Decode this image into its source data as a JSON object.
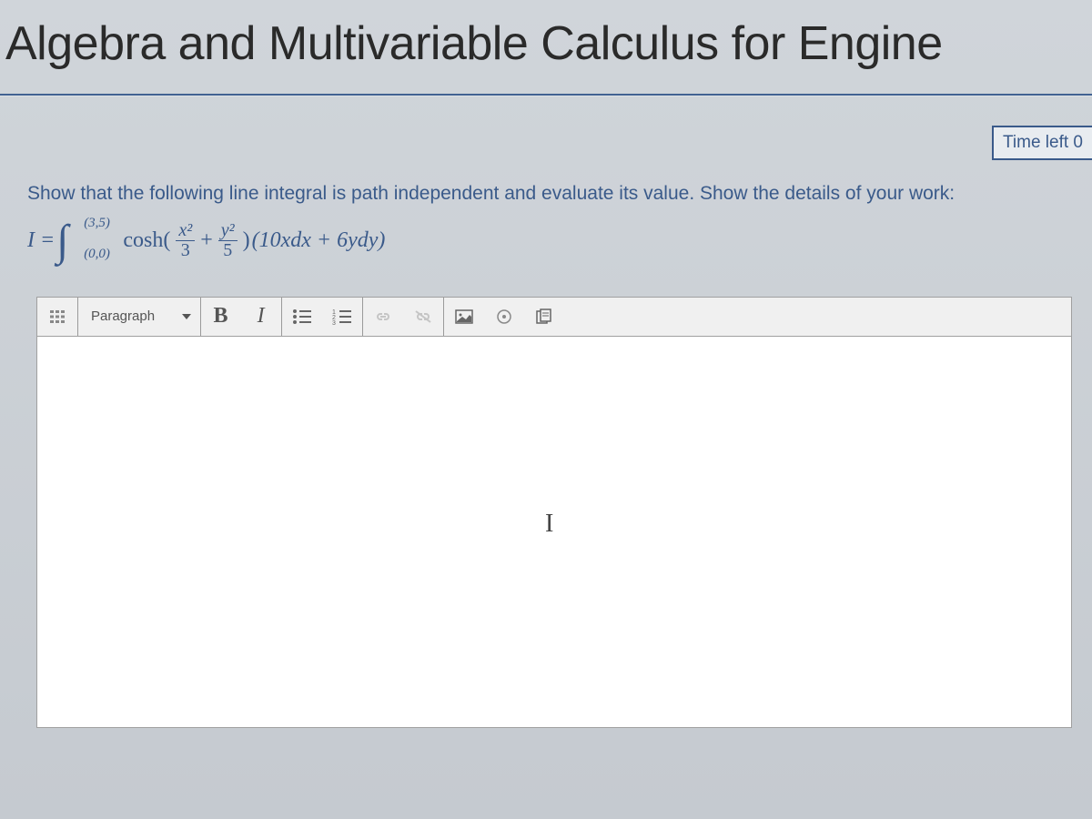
{
  "header": {
    "title": "Algebra and Multivariable Calculus for Engine",
    "timer_label": "Time left 0"
  },
  "question": {
    "prompt": "Show that the following line integral is path independent and evaluate its value. Show the details of your work:",
    "equation": {
      "lhs": "I =",
      "int_upper": "(3,5)",
      "int_lower": "(0,0)",
      "cosh": "cosh(",
      "frac1_num": "x²",
      "frac1_den": "3",
      "plus": "+",
      "frac2_num": "y²",
      "frac2_den": "5",
      "close": ")",
      "tail": "(10xdx + 6ydy)"
    }
  },
  "toolbar": {
    "format_select": "Paragraph",
    "bold": "B",
    "italic": "I"
  },
  "editor": {
    "cursor_glyph": "I"
  }
}
